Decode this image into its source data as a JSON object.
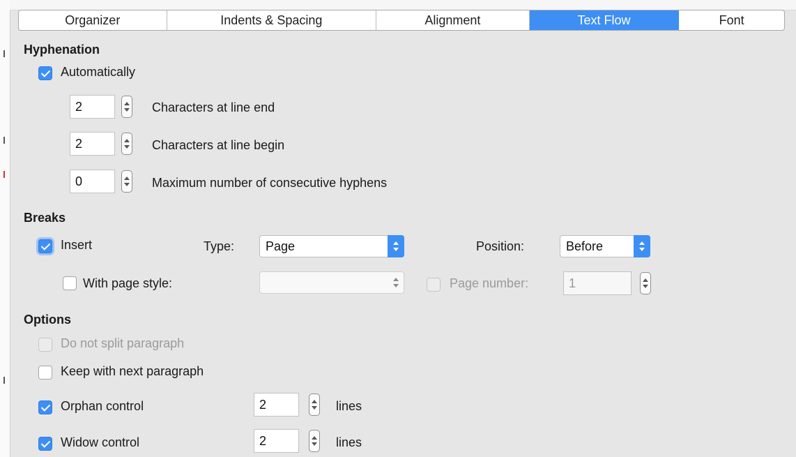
{
  "tabs": [
    {
      "label": "Organizer",
      "active": false
    },
    {
      "label": "Indents & Spacing",
      "active": false
    },
    {
      "label": "Alignment",
      "active": false
    },
    {
      "label": "Text Flow",
      "active": true
    },
    {
      "label": "Font",
      "active": false
    }
  ],
  "hyphenation": {
    "heading": "Hyphenation",
    "automatically": {
      "label": "Automatically",
      "checked": true
    },
    "chars_line_end": {
      "value": "2",
      "label": "Characters at line end"
    },
    "chars_line_begin": {
      "value": "2",
      "label": "Characters at line begin"
    },
    "max_consecutive": {
      "value": "0",
      "label": "Maximum number of consecutive hyphens"
    }
  },
  "breaks": {
    "heading": "Breaks",
    "insert": {
      "label": "Insert",
      "checked": true
    },
    "type_label": "Type:",
    "type_value": "Page",
    "position_label": "Position:",
    "position_value": "Before",
    "with_page_style": {
      "label": "With page style:",
      "checked": false
    },
    "page_style_value": "",
    "page_number": {
      "label": "Page number:",
      "checked": false,
      "value": "1"
    }
  },
  "options": {
    "heading": "Options",
    "do_not_split": {
      "label": "Do not split paragraph",
      "checked": false,
      "disabled": true
    },
    "keep_with_next": {
      "label": "Keep with next paragraph",
      "checked": false
    },
    "orphan": {
      "label": "Orphan control",
      "checked": true,
      "value": "2",
      "unit": "lines"
    },
    "widow": {
      "label": "Widow control",
      "checked": true,
      "value": "2",
      "unit": "lines"
    }
  },
  "colors": {
    "accent": "#3d8ff4",
    "background": "#e6e6e6"
  }
}
